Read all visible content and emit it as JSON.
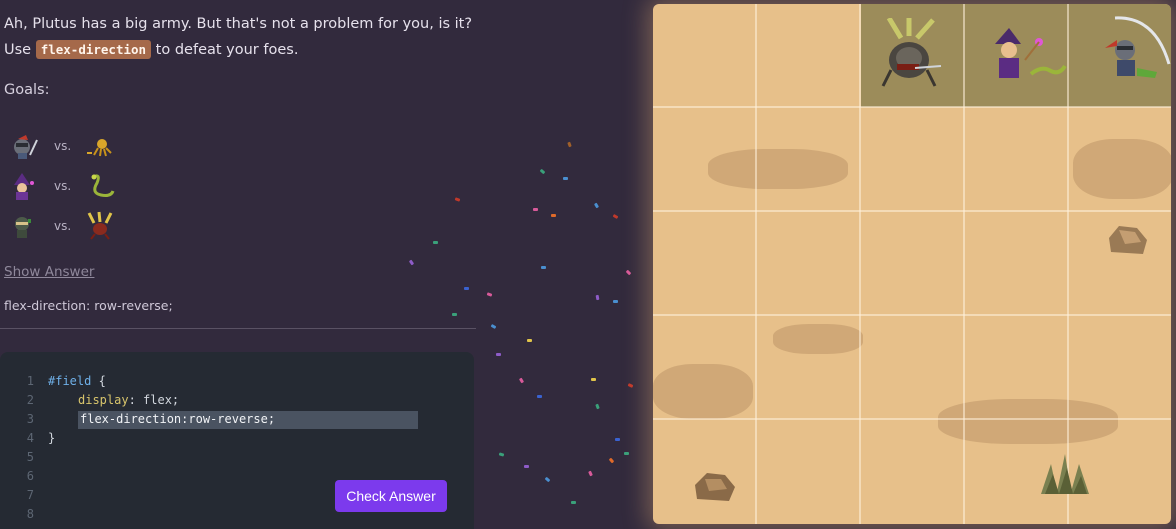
{
  "intro": {
    "line1": "Ah, Plutus has a big army. But that's not a problem for you, is it?",
    "line2_prefix": "Use",
    "line2_code": "flex-direction",
    "line2_suffix": "to defeat your foes."
  },
  "goals": {
    "title": "Goals:",
    "vs_label": "vs.",
    "rows": [
      {
        "hero": "red-helmet-knight",
        "foe": "yellow-octopus"
      },
      {
        "hero": "purple-wizard",
        "foe": "green-snake"
      },
      {
        "hero": "green-ninja",
        "foe": "red-beetle"
      }
    ]
  },
  "show_answer": "Show Answer",
  "answer_text": "flex-direction: row-reverse;",
  "editor": {
    "line_numbers": [
      "1",
      "2",
      "3",
      "4",
      "5",
      "6",
      "7",
      "8"
    ],
    "line1_selector": "#field",
    "line1_brace": " {",
    "line2_prop": "display",
    "line2_value": ": flex;",
    "input_value": "flex-direction:row-reverse;",
    "line4": "}"
  },
  "check_button": "Check Answer",
  "colors": {
    "background": "#322a3d",
    "editor_bg": "#252a33",
    "button": "#7c3aed",
    "code_pill": "#a5694a",
    "board_sand": "#e7c08a",
    "highlight_row": "#9c8c5a"
  },
  "board": {
    "grid": "5x5",
    "units": [
      "beetle-enemy",
      "wizard-enemy",
      "knight-enemy"
    ],
    "props": [
      "rock",
      "rock",
      "rock",
      "desert-plant"
    ]
  }
}
